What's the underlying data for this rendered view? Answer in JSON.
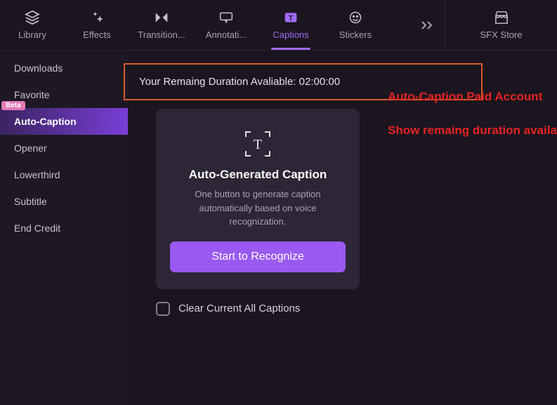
{
  "topbar": {
    "tabs": [
      {
        "label": "Library"
      },
      {
        "label": "Effects"
      },
      {
        "label": "Transition..."
      },
      {
        "label": "Annotati..."
      },
      {
        "label": "Captions"
      },
      {
        "label": "Stickers"
      }
    ],
    "sfx_store": "SFX Store"
  },
  "sidebar": {
    "items": [
      {
        "label": "Downloads"
      },
      {
        "label": "Favorite"
      },
      {
        "label": "Auto-Caption",
        "badge": "Beta"
      },
      {
        "label": "Opener"
      },
      {
        "label": "Lowerthird"
      },
      {
        "label": "Subtitle"
      },
      {
        "label": "End Credit"
      }
    ]
  },
  "duration_banner": {
    "prefix": "Your Remaing Duration Avaliable: ",
    "value": "02:00:00"
  },
  "card": {
    "title": "Auto-Generated Caption",
    "description": "One button to generate caption automatically based on voice recognization.",
    "button": "Start to Recognize"
  },
  "clear_caption_label": "Clear Current All Captions",
  "annotations": {
    "title": "Auto-Caption Paid Account",
    "subtitle": "Show remaing duration available of your account"
  }
}
